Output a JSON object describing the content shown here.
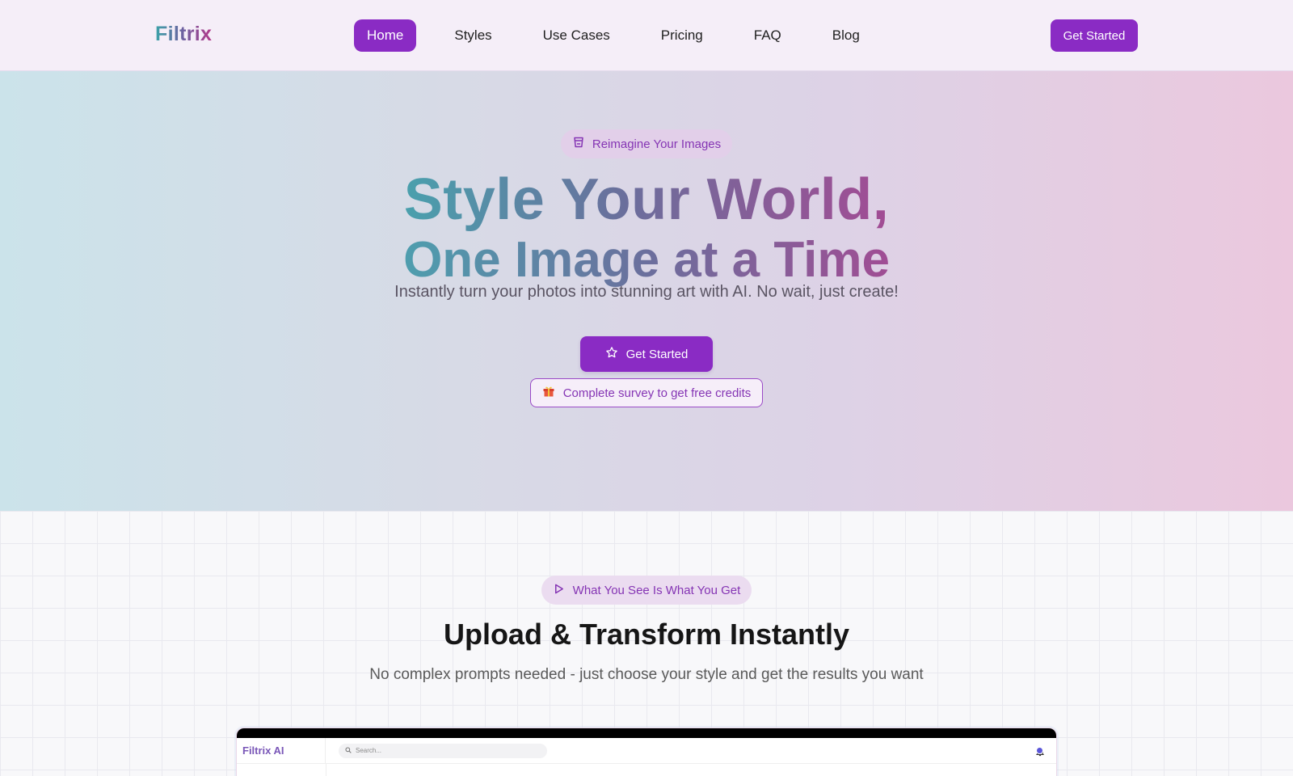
{
  "nav": {
    "logo": "Filtrix",
    "links": [
      {
        "label": "Home",
        "active": true
      },
      {
        "label": "Styles",
        "active": false
      },
      {
        "label": "Use Cases",
        "active": false
      },
      {
        "label": "Pricing",
        "active": false
      },
      {
        "label": "FAQ",
        "active": false
      },
      {
        "label": "Blog",
        "active": false
      }
    ],
    "cta_label": "Get Started"
  },
  "hero": {
    "badge": {
      "icon": "trash-cup-icon",
      "label": "Reimagine Your Images"
    },
    "title_line1": "Style Your World,",
    "title_line2": "One Image at a Time",
    "subtitle": "Instantly turn your photos into stunning art with AI. No wait, just create!",
    "cta": {
      "icon": "star-icon",
      "label": "Get Started"
    },
    "survey": {
      "icon": "gift-icon",
      "label": "Complete survey to get free credits"
    }
  },
  "section": {
    "badge": {
      "icon": "play-icon",
      "label": "What You See Is What You Get"
    },
    "title": "Upload & Transform Instantly",
    "subtitle": "No complex prompts needed - just choose your style and get the results you want"
  },
  "preview": {
    "logo": "Filtrix AI",
    "search_placeholder": "Search..."
  },
  "colors": {
    "accent": "#8a2bc4",
    "nav_bg": "#f5eef8",
    "badge_text": "#8535b4"
  }
}
